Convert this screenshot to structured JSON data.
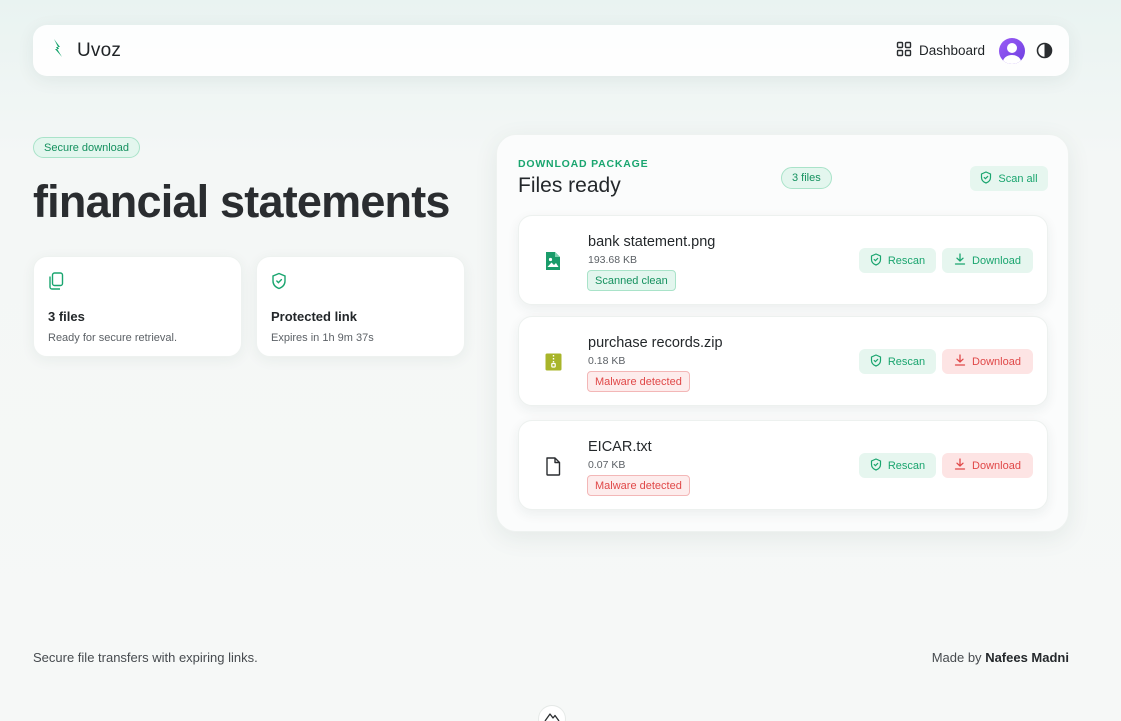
{
  "nav": {
    "brand": "Uvoz",
    "dashboard_label": "Dashboard"
  },
  "hero": {
    "badge": "Secure download",
    "title": "financial statements",
    "cards": [
      {
        "title": "3 files",
        "subtitle": "Ready for secure retrieval."
      },
      {
        "title": "Protected link",
        "subtitle": "Expires in 1h 9m 37s"
      }
    ]
  },
  "panel": {
    "kicker": "DOWNLOAD PACKAGE",
    "title": "Files ready",
    "count_pill": "3 files",
    "scan_all_label": "Scan all",
    "files": [
      {
        "name": "bank statement.png",
        "size": "193.68 KB",
        "status": "Scanned clean",
        "rescan": "Rescan",
        "download": "Download",
        "icon": "image-file-icon"
      },
      {
        "name": "purchase records.zip",
        "size": "0.18 KB",
        "status": "Malware detected",
        "rescan": "Rescan",
        "download": "Download",
        "icon": "zip-file-icon"
      },
      {
        "name": "EICAR.txt",
        "size": "0.07 KB",
        "status": "Malware detected",
        "rescan": "Rescan",
        "download": "Download",
        "icon": "document-file-icon"
      }
    ]
  },
  "footer": {
    "tagline": "Secure file transfers with expiring links.",
    "made_by_prefix": "Made by",
    "author": "Nafees Madni"
  },
  "colors": {
    "accent": "#1aa56f",
    "danger": "#e04848",
    "avatar": "#7c4ae8",
    "zip_icon": "#a8b52a"
  }
}
